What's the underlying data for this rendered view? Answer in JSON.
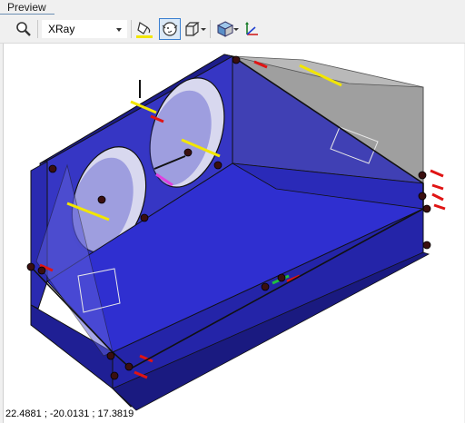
{
  "panel": {
    "title": "Preview"
  },
  "toolbar": {
    "zoom_icon": "magnifier-icon",
    "render_mode": {
      "selected": "XRay"
    },
    "paint_icon": "paint-bucket-icon",
    "view_icon": "face-view-icon",
    "box_icon": "wireframe-box-icon",
    "display_icon": "display-cube-icon",
    "axes_icon": "axes-icon",
    "colors": {
      "paint_underline": "#f2e600",
      "accent": "#3a7fd0"
    }
  },
  "viewport": {
    "colors": {
      "model_blue": "#2222b8",
      "back_panel": "#3a3acd",
      "gray_panel": "#9a9a9a",
      "edge": "#0a0a40"
    }
  },
  "status": {
    "coordinates": "22.4881 ; -20.0131 ; 17.3819"
  }
}
